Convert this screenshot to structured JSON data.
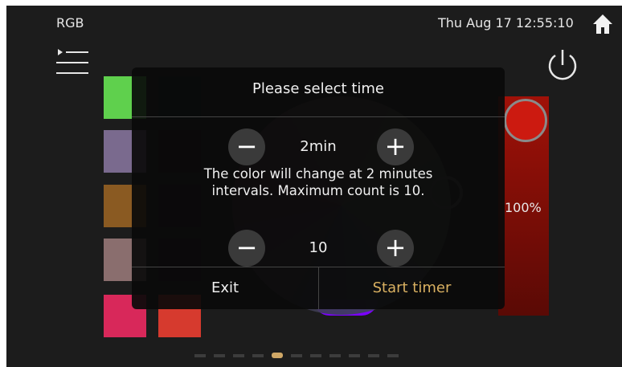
{
  "status_bar": {
    "title": "RGB",
    "datetime": "Thu Aug 17  12:55:10"
  },
  "icons": {
    "home": "home-icon",
    "menu": "menu-list-icon",
    "power": "power-icon"
  },
  "color_slider": {
    "brightness_label": "100%",
    "brightness_fraction": 1.0
  },
  "swatches": {
    "column_1": [
      "#5fd04d",
      "#7a6a8e",
      "#8a5a22",
      "#8a6e6e",
      "#d8285a"
    ],
    "column_2": [
      "#0b1a1a",
      "#1a0c12",
      "#1e0820",
      "#1c0a1c",
      "#d63a2e"
    ]
  },
  "page_indicator": {
    "count": 11,
    "active_index": 4
  },
  "dialog": {
    "title": "Please select time",
    "interval": {
      "minus": "−",
      "value": "2min",
      "plus": "+"
    },
    "message": "The color will change at 2 minutes intervals. Maximum count is 10.",
    "count": {
      "minus": "−",
      "value": "10",
      "plus": "+"
    },
    "exit_label": "Exit",
    "start_label": "Start timer",
    "accent_color": "#d9b061"
  }
}
